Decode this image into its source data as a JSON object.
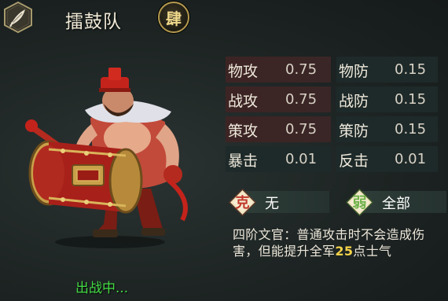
{
  "unit": {
    "name": "擂鼓队",
    "rank_char": "肆",
    "status": "出战中..."
  },
  "stats": [
    {
      "label": "物攻",
      "value": "0.75",
      "label2": "物防",
      "value2": "0.15",
      "highlight": true
    },
    {
      "label": "战攻",
      "value": "0.75",
      "label2": "战防",
      "value2": "0.15",
      "highlight": true
    },
    {
      "label": "策攻",
      "value": "0.75",
      "label2": "策防",
      "value2": "0.15",
      "highlight": true
    },
    {
      "label": "暴击",
      "value": "0.01",
      "label2": "反击",
      "value2": "0.01",
      "highlight": false
    }
  ],
  "counters": {
    "strong": {
      "tag": "克",
      "text": "无",
      "color": "#c0392b"
    },
    "weak": {
      "tag": "弱",
      "text": "全部",
      "color": "#6fb24a"
    }
  },
  "description": {
    "before": "四阶文官：普通攻击时不会造成伤害，但能提升全军",
    "number": "25",
    "after": "点士气"
  },
  "icons": [
    "feather-icon",
    "drummer-character"
  ]
}
